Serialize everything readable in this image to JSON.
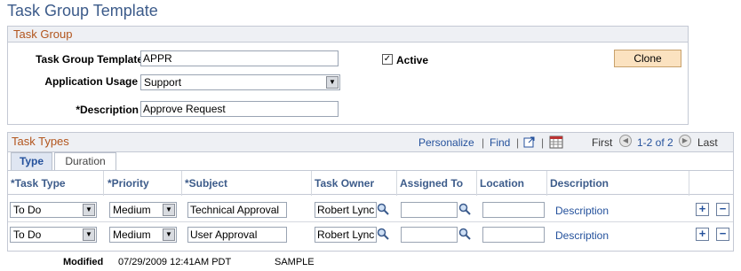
{
  "page": {
    "title": "Task Group Template"
  },
  "group": {
    "header": "Task Group",
    "template_label": "Task Group Template",
    "template_value": "APPR",
    "active_label": "Active",
    "active_checked": true,
    "usage_label": "Application Usage",
    "usage_value": "Support",
    "description_label": "*Description",
    "description_value": "Approve Request",
    "clone_label": "Clone"
  },
  "types": {
    "title": "Task Types",
    "personalize": "Personalize",
    "find": "Find",
    "first": "First",
    "range": "1-2 of 2",
    "last": "Last",
    "tabs": [
      {
        "label": "Type"
      },
      {
        "label": "Duration"
      }
    ],
    "columns": {
      "task_type": "*Task Type",
      "priority": "*Priority",
      "subject": "*Subject",
      "task_owner": "Task Owner",
      "assigned_to": "Assigned To",
      "location": "Location",
      "description": "Description"
    },
    "rows": [
      {
        "task_type": "To Do",
        "priority": "Medium",
        "subject": "Technical Approval",
        "task_owner": "Robert Lync",
        "assigned_to": "",
        "location": "",
        "description": "Description"
      },
      {
        "task_type": "To Do",
        "priority": "Medium",
        "subject": "User Approval",
        "task_owner": "Robert Lync",
        "assigned_to": "",
        "location": "",
        "description": "Description"
      }
    ]
  },
  "footer": {
    "modified_label": "Modified",
    "modified_value": "07/29/2009 12:41AM PDT",
    "user": "SAMPLE"
  }
}
